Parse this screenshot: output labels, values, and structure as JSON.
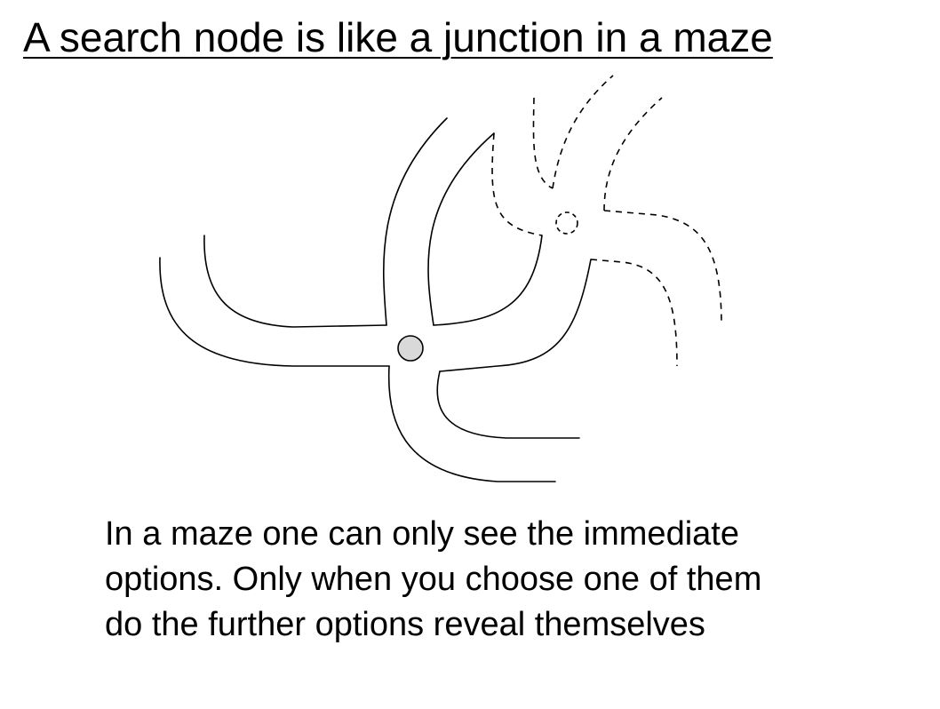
{
  "slide": {
    "title": "A search node is like a junction in a maze",
    "caption_lines": [
      "In a maze one can only see the immediate",
      "options. Only when you choose one of them",
      "do the further options reveal themselves"
    ]
  },
  "diagram": {
    "current_node_color": "#d9d9d9",
    "hidden_paths_style": "dashed"
  }
}
